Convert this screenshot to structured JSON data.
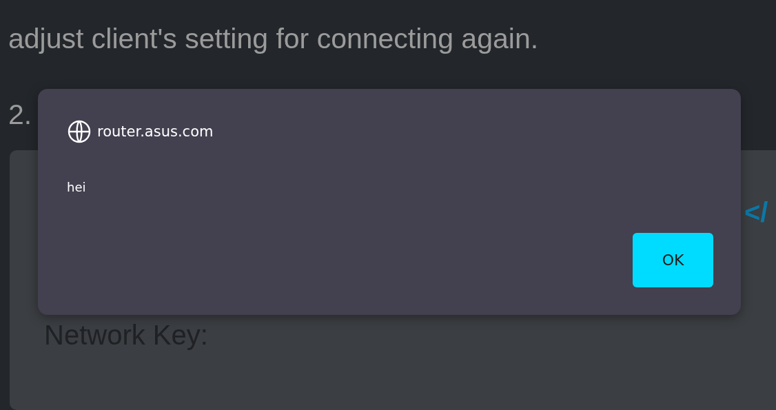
{
  "page": {
    "paragraph": "adjust client's setting for connecting again.",
    "step_number": "2.",
    "panel": {
      "code_mark": "</",
      "field_label": "Network Key:"
    }
  },
  "dialog": {
    "origin": "router.asus.com",
    "message": "hei",
    "buttons": [
      "OK"
    ]
  }
}
